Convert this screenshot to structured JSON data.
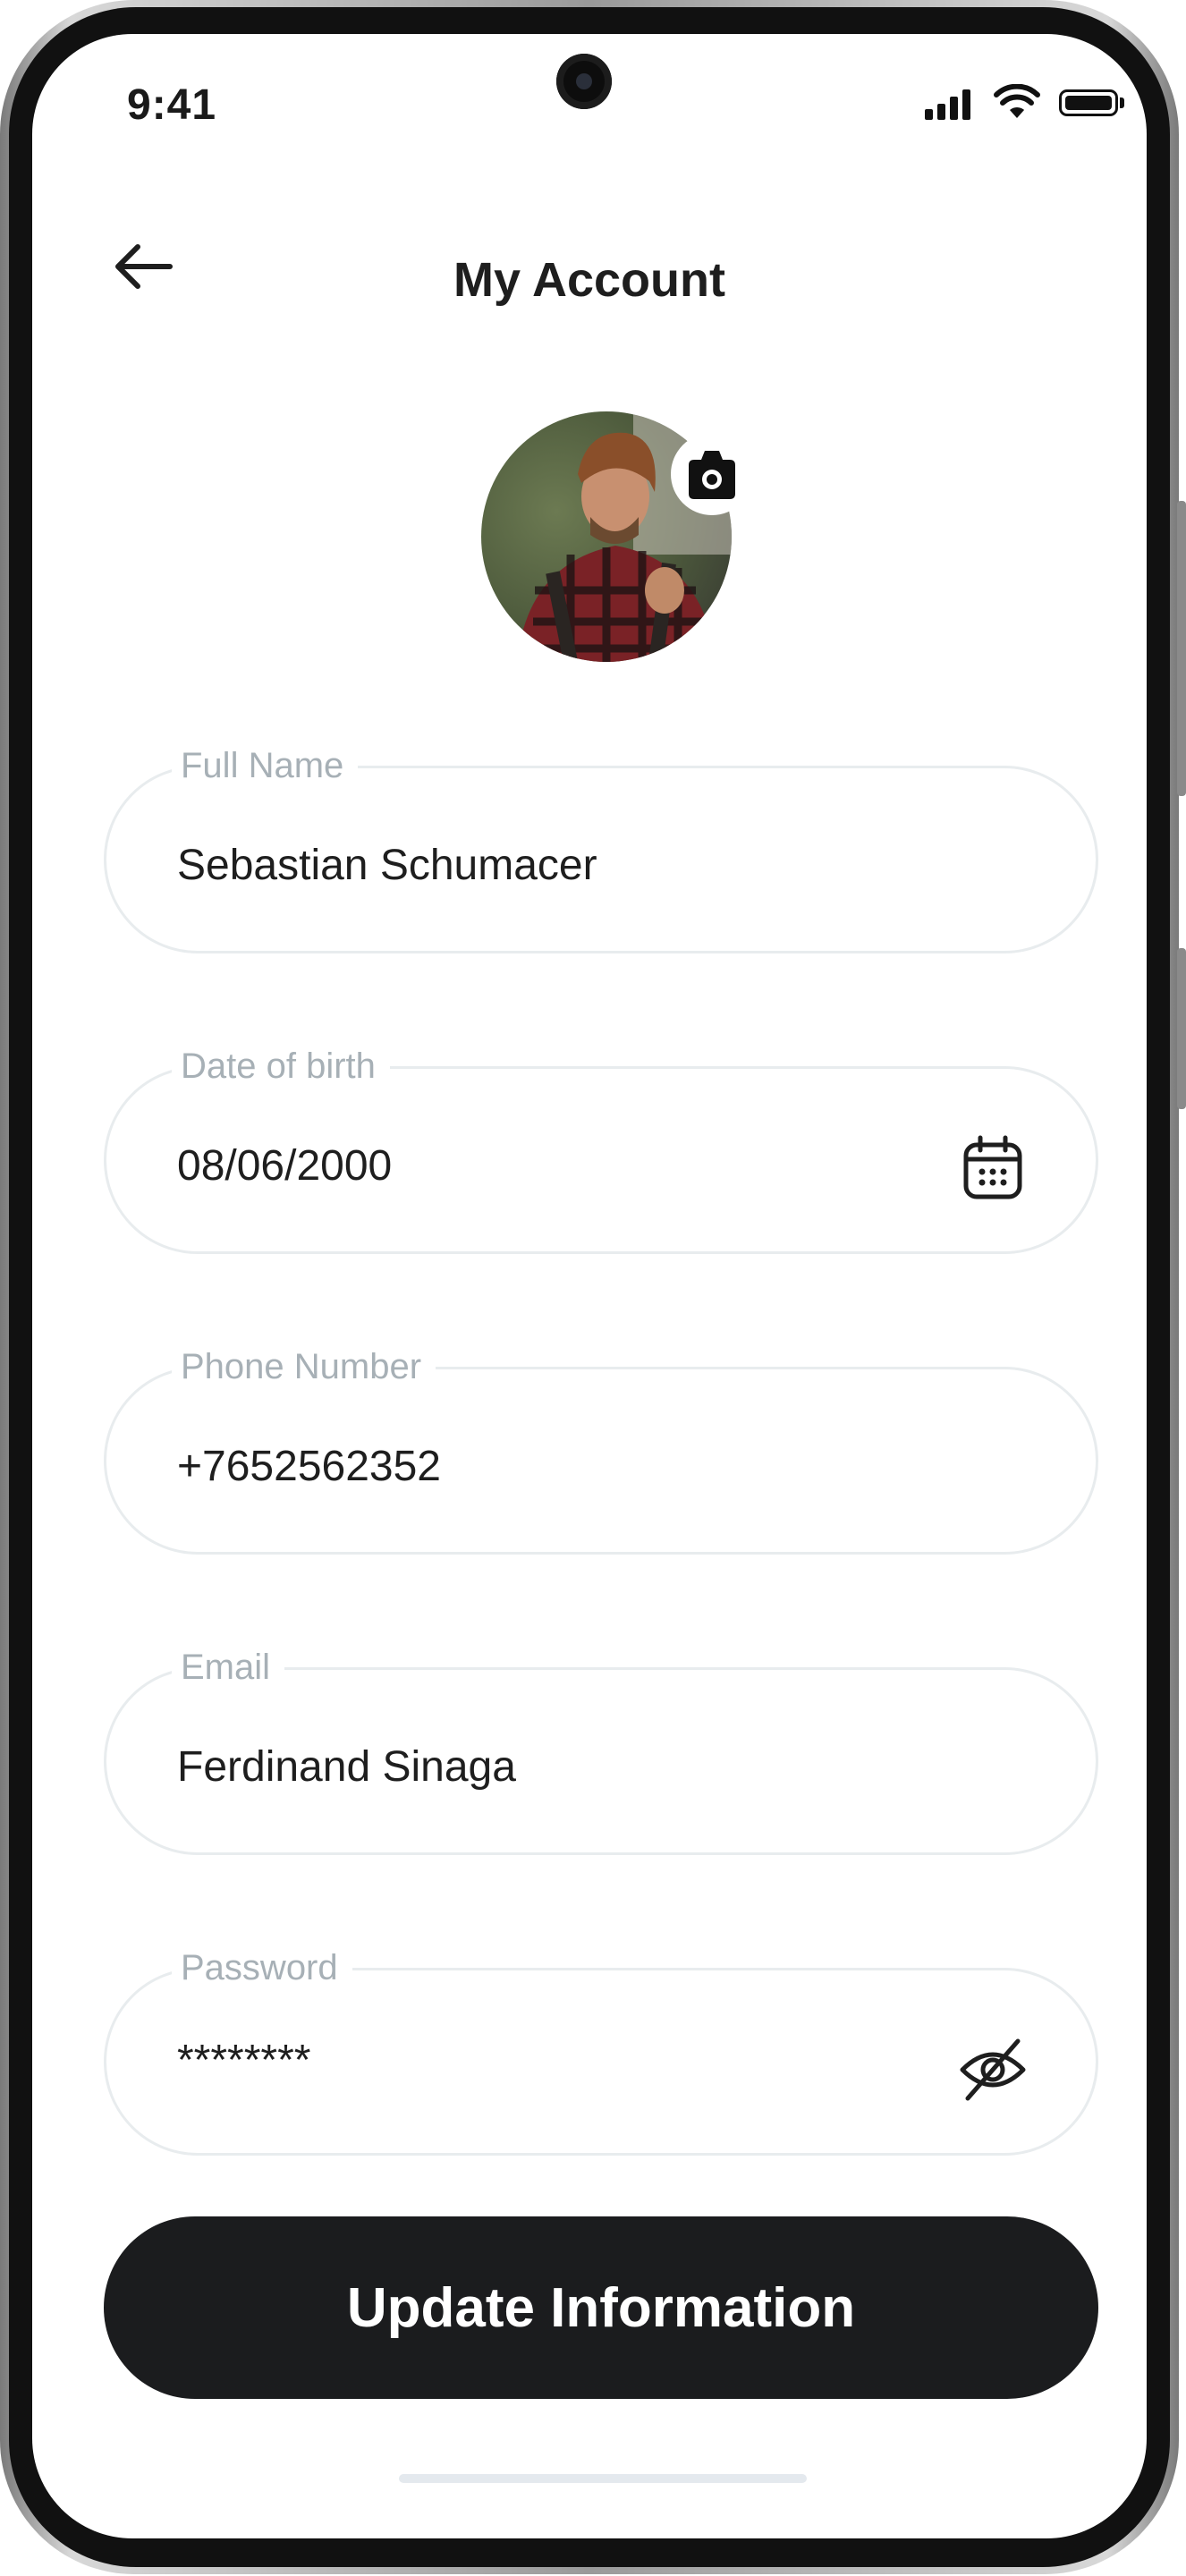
{
  "status_bar": {
    "time": "9:41"
  },
  "header": {
    "title": "My Account"
  },
  "form": {
    "full_name": {
      "label": "Full Name",
      "value": "Sebastian Schumacer"
    },
    "date_of_birth": {
      "label": "Date of birth",
      "value": "08/06/2000"
    },
    "phone": {
      "label": "Phone Number",
      "value": "+7652562352"
    },
    "email": {
      "label": "Email",
      "value": "Ferdinand Sinaga"
    },
    "password": {
      "label": "Password",
      "value": "********"
    }
  },
  "actions": {
    "update_label": "Update Information"
  },
  "icons": {
    "back": "arrow-left-icon",
    "camera": "camera-icon",
    "calendar": "calendar-icon",
    "visibility": "eye-off-icon"
  },
  "colors": {
    "button_bg": "#1b1c1e",
    "field_border": "#e8ecee",
    "label": "#a7b0b6",
    "text": "#1e1e1e"
  }
}
